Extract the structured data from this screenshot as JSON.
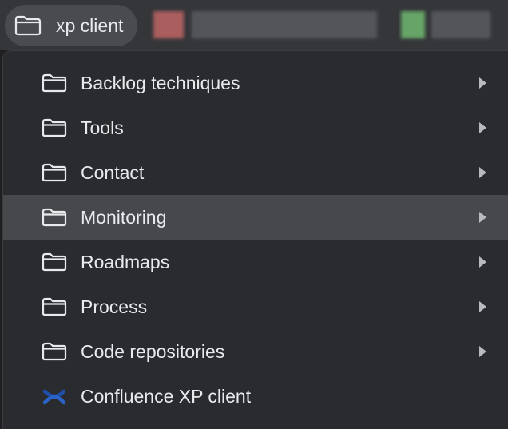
{
  "bookmarks_bar": {
    "folder_label": "xp client",
    "folder_icon": "folder-icon"
  },
  "menu": {
    "items": [
      {
        "label": "Backlog techniques",
        "icon": "folder-icon",
        "has_submenu": true,
        "highlighted": false
      },
      {
        "label": "Tools",
        "icon": "folder-icon",
        "has_submenu": true,
        "highlighted": false
      },
      {
        "label": "Contact",
        "icon": "folder-icon",
        "has_submenu": true,
        "highlighted": false
      },
      {
        "label": "Monitoring",
        "icon": "folder-icon",
        "has_submenu": true,
        "highlighted": true
      },
      {
        "label": "Roadmaps",
        "icon": "folder-icon",
        "has_submenu": true,
        "highlighted": false
      },
      {
        "label": "Process",
        "icon": "folder-icon",
        "has_submenu": true,
        "highlighted": false
      },
      {
        "label": "Code repositories",
        "icon": "folder-icon",
        "has_submenu": true,
        "highlighted": false
      },
      {
        "label": "Confluence XP client",
        "icon": "confluence-icon",
        "has_submenu": false,
        "highlighted": false
      }
    ]
  },
  "colors": {
    "background": "#1f1f21",
    "menu_background": "#2a2b2e",
    "highlight": "#47484b",
    "text": "#e8eaed",
    "icon_stroke": "#e8eaed",
    "confluence_blue": "#1d4fa8"
  }
}
